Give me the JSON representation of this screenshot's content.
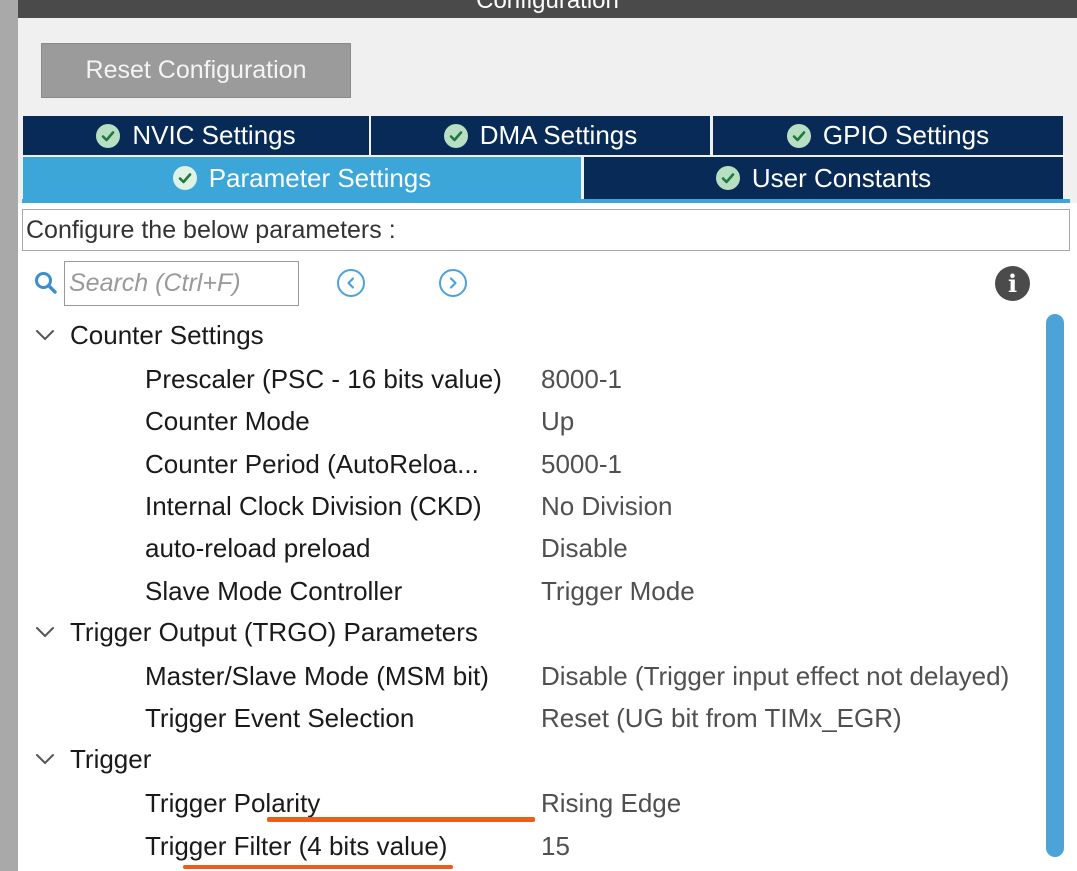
{
  "window": {
    "title": "Configuration"
  },
  "toolbar": {
    "reset_label": "Reset Configuration"
  },
  "tabs": [
    {
      "label": "NVIC Settings",
      "active": false
    },
    {
      "label": "DMA Settings",
      "active": false
    },
    {
      "label": "GPIO Settings",
      "active": false
    },
    {
      "label": "Parameter Settings",
      "active": true
    },
    {
      "label": "User Constants",
      "active": false
    }
  ],
  "description": "Configure the below parameters :",
  "search": {
    "placeholder": "Search (Ctrl+F)",
    "value": ""
  },
  "groups": [
    {
      "label": "Counter Settings",
      "expanded": true,
      "params": [
        {
          "name": "Prescaler (PSC - 16 bits value)",
          "value": "8000-1"
        },
        {
          "name": "Counter Mode",
          "value": "Up"
        },
        {
          "name": "Counter Period (AutoReloa...",
          "value": "5000-1"
        },
        {
          "name": "Internal Clock Division (CKD)",
          "value": "No Division"
        },
        {
          "name": "auto-reload preload",
          "value": "Disable"
        },
        {
          "name": "Slave Mode Controller",
          "value": "Trigger Mode"
        }
      ]
    },
    {
      "label": "Trigger Output (TRGO) Parameters",
      "expanded": true,
      "params": [
        {
          "name": "Master/Slave Mode (MSM bit)",
          "value": "Disable (Trigger input effect not delayed)"
        },
        {
          "name": "Trigger Event Selection",
          "value": "Reset (UG bit from TIMx_EGR)"
        }
      ]
    },
    {
      "label": "Trigger",
      "expanded": true,
      "params": [
        {
          "name": "Trigger Polarity",
          "value": "Rising Edge"
        },
        {
          "name": "Trigger Filter (4 bits value)",
          "value": "15"
        }
      ]
    }
  ],
  "colors": {
    "tab_inactive": "#082a57",
    "tab_active": "#3ca6d9",
    "accent": "#4ca3d8",
    "annotation": "#f05a1a"
  }
}
